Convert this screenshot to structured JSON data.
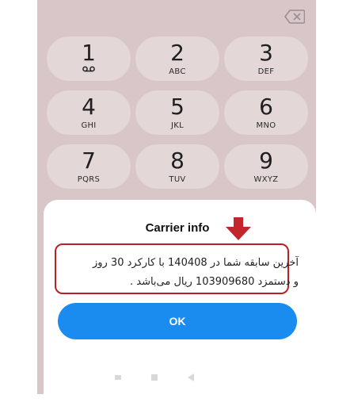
{
  "keypad": {
    "keys": [
      {
        "digit": "1",
        "letters": ""
      },
      {
        "digit": "2",
        "letters": "ABC"
      },
      {
        "digit": "3",
        "letters": "DEF"
      },
      {
        "digit": "4",
        "letters": "GHI"
      },
      {
        "digit": "5",
        "letters": "JKL"
      },
      {
        "digit": "6",
        "letters": "MNO"
      },
      {
        "digit": "7",
        "letters": "PQRS"
      },
      {
        "digit": "8",
        "letters": "TUV"
      },
      {
        "digit": "9",
        "letters": "WXYZ"
      }
    ]
  },
  "dialog": {
    "title": "Carrier info",
    "message_line1": "آخرین سابقه شما در 140408 با کارکرد 30 روز",
    "message_line2": "و دستمزد  103909680 ریال می‌باشد .",
    "ok_label": "OK"
  },
  "colors": {
    "keypad_bg": "#d8c6c8",
    "ok_button": "#1a8cf0",
    "highlight": "#b52127"
  }
}
